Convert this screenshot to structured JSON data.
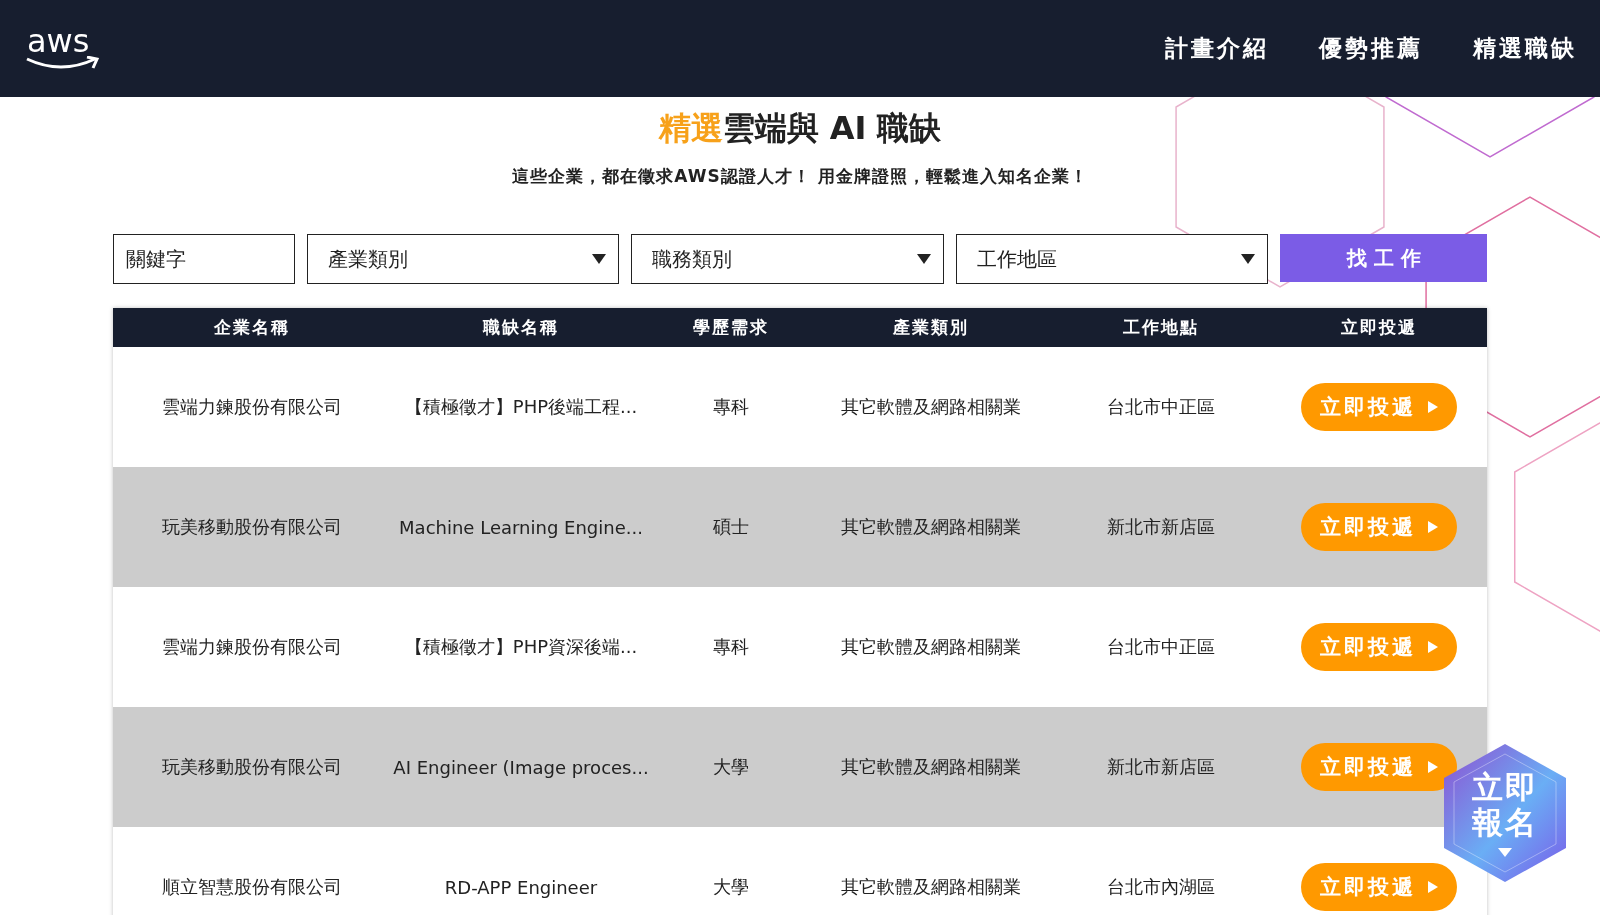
{
  "header": {
    "logo": "aws",
    "nav": [
      {
        "label": "計畫介紹"
      },
      {
        "label": "優勢推薦"
      },
      {
        "label": "精選職缺"
      }
    ]
  },
  "heading": {
    "highlight": "精選",
    "text": "雲端與 AI 職缺"
  },
  "subtitle": "這些企業，都在徵求AWS認證人才！ 用金牌證照，輕鬆進入知名企業！",
  "filters": {
    "keyword": {
      "placeholder": "關鍵字"
    },
    "dropdowns": [
      {
        "value": "產業類別"
      },
      {
        "value": "職務類別"
      },
      {
        "value": "工作地區"
      }
    ],
    "button": "找 工 作"
  },
  "table": {
    "columns": [
      "企業名稱",
      "職缺名稱",
      "學歷需求",
      "產業類別",
      "工作地點",
      "立即投遞"
    ],
    "rows": [
      {
        "company": "雲端力鍊股份有限公司",
        "job": "【積極徵才】PHP後端工程...",
        "education": "專科",
        "industry": "其它軟體及網路相關業",
        "location": "台北市中正區",
        "action": "立即投遞"
      },
      {
        "company": "玩美移動股份有限公司",
        "job": "Machine Learning Engine...",
        "education": "碩士",
        "industry": "其它軟體及網路相關業",
        "location": "新北市新店區",
        "action": "立即投遞"
      },
      {
        "company": "雲端力鍊股份有限公司",
        "job": "【積極徵才】PHP資深後端...",
        "education": "專科",
        "industry": "其它軟體及網路相關業",
        "location": "台北市中正區",
        "action": "立即投遞"
      },
      {
        "company": "玩美移動股份有限公司",
        "job": "AI Engineer (Image proces...",
        "education": "大學",
        "industry": "其它軟體及網路相關業",
        "location": "新北市新店區",
        "action": "立即投遞"
      },
      {
        "company": "順立智慧股份有限公司",
        "job": "RD-APP Engineer",
        "education": "大學",
        "industry": "其它軟體及網路相關業",
        "location": "台北市內湖區",
        "action": "立即投遞"
      }
    ]
  },
  "signup_badge": {
    "line_1": "立即",
    "line_2": "報名"
  }
}
